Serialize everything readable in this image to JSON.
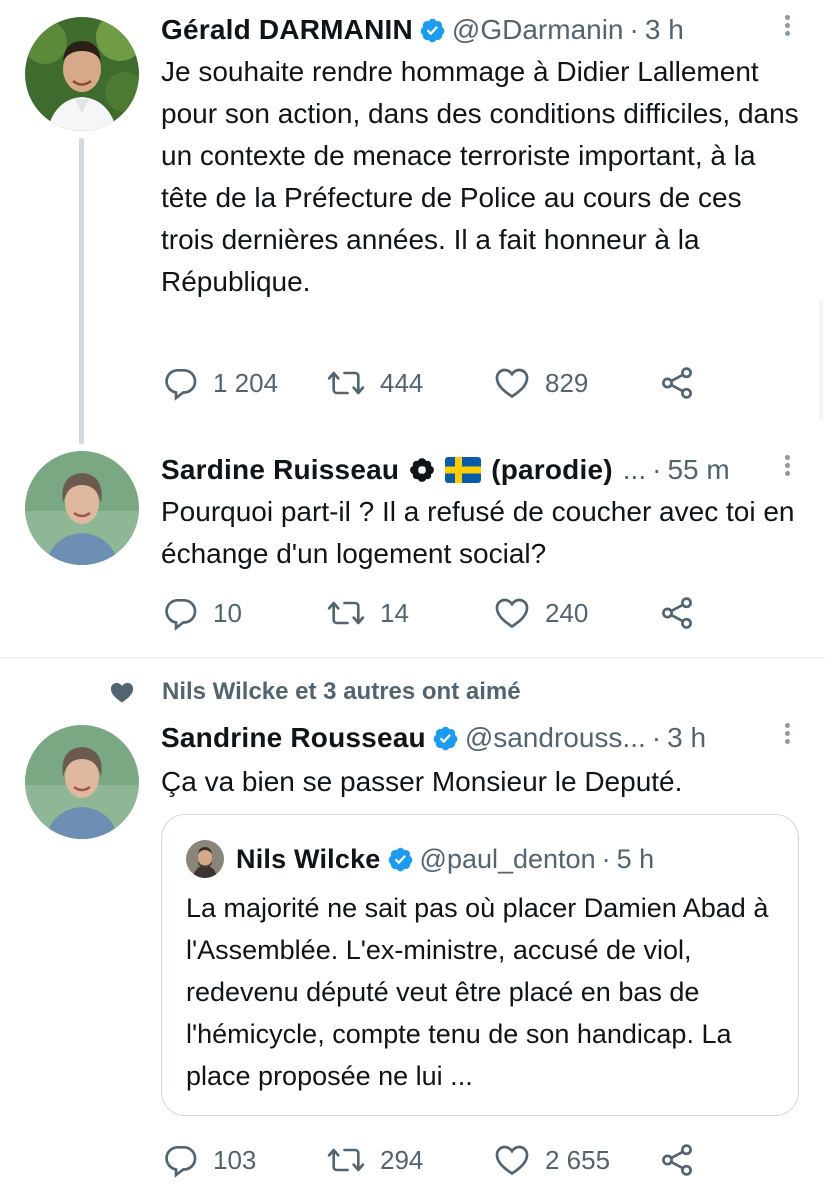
{
  "tweets": [
    {
      "name": "Gérald DARMANIN",
      "handle": "@GDarmanin",
      "time": "3 h",
      "text": "Je souhaite rendre hommage à Didier Lallement pour son action, dans des conditions difficiles, dans un contexte de menace terroriste important, à la tête de la Préfecture de Police au cours de ces trois dernières années. Il a fait honneur à la République.",
      "replies": "1 204",
      "retweets": "444",
      "likes": "829"
    },
    {
      "name": "Sardine Ruisseau",
      "label": "(parodie)",
      "handle_truncated": "...",
      "time": "55 m",
      "text": "Pourquoi part-il ? Il a refusé de coucher avec toi en échange d'un logement social?",
      "replies": "10",
      "retweets": "14",
      "likes": "240"
    },
    {
      "social_context": "Nils Wilcke et 3 autres ont aimé",
      "name": "Sandrine Rousseau",
      "handle": "@sandrouss...",
      "time": "3 h",
      "text": "Ça va bien se passer Monsieur le Deputé.",
      "replies": "103",
      "retweets": "294",
      "likes": "2 655",
      "quoted": {
        "name": "Nils Wilcke",
        "handle": "@paul_denton",
        "time": "5 h",
        "text": "La majorité ne sait pas où placer Damien Abad à l'Assemblée. L'ex-ministre, accusé de viol, redevenu député veut être placé en bas de l'hémicycle, compte tenu de son handicap. La place proposée ne lui ..."
      }
    }
  ],
  "separator": "·",
  "colors": {
    "verified": "#1d9bf0",
    "muted": "#536471",
    "text": "#0f1419",
    "border": "#cfd9de"
  },
  "icons": [
    "verified-badge-icon",
    "more-icon",
    "reply-icon",
    "retweet-icon",
    "like-icon",
    "share-icon",
    "heart-filled-icon",
    "flower-badge-icon",
    "sweden-flag-icon"
  ]
}
